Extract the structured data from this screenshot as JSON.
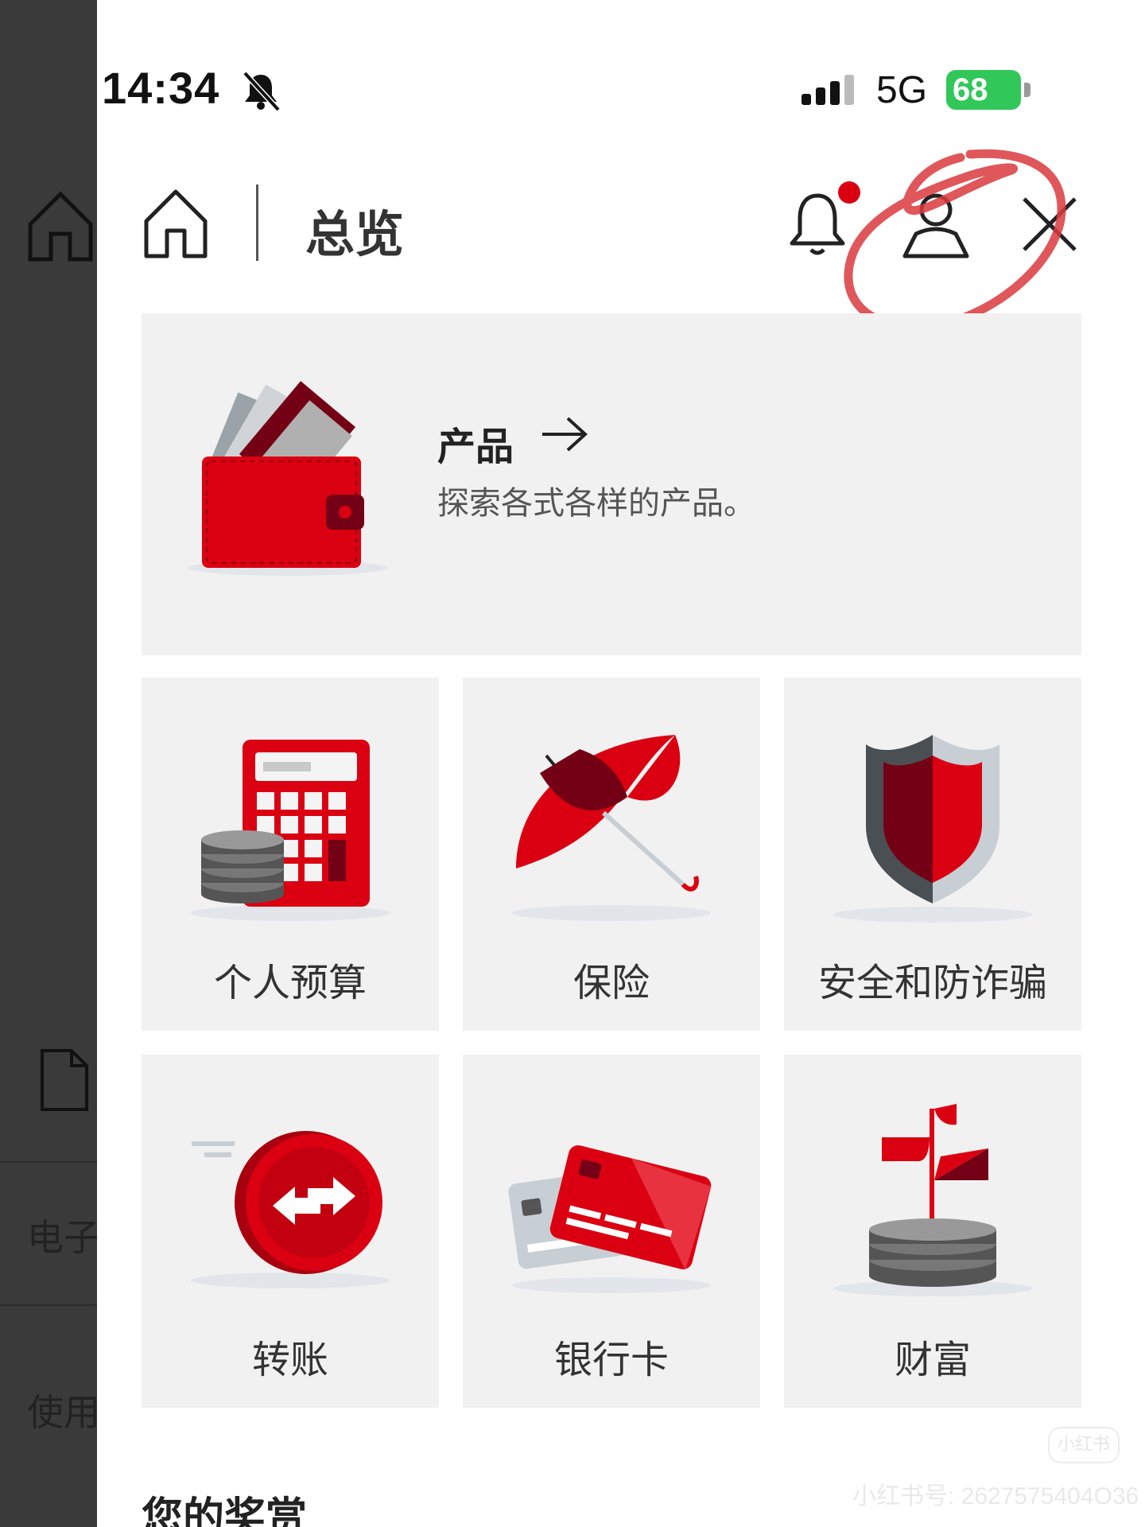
{
  "background": {
    "text_1": "电子",
    "text_2": "使用"
  },
  "status_bar": {
    "time": "14:34",
    "network": "5G",
    "battery": "68"
  },
  "header": {
    "title": "总览"
  },
  "product_banner": {
    "title": "产品",
    "description": "探索各式各样的产品。"
  },
  "tiles": [
    {
      "label": "个人预算"
    },
    {
      "label": "保险"
    },
    {
      "label": "安全和防诈骗"
    },
    {
      "label": "转账"
    },
    {
      "label": "银行卡"
    },
    {
      "label": "财富"
    }
  ],
  "rewards": {
    "title": "您的奖赏"
  },
  "watermark": {
    "text": "小红书号: 2627575404O36",
    "badge": "小红书"
  },
  "colors": {
    "brand_red": "#db0011",
    "dark_red": "#730014",
    "tile_bg": "#f1f1f1",
    "annotation": "#d9393e"
  }
}
